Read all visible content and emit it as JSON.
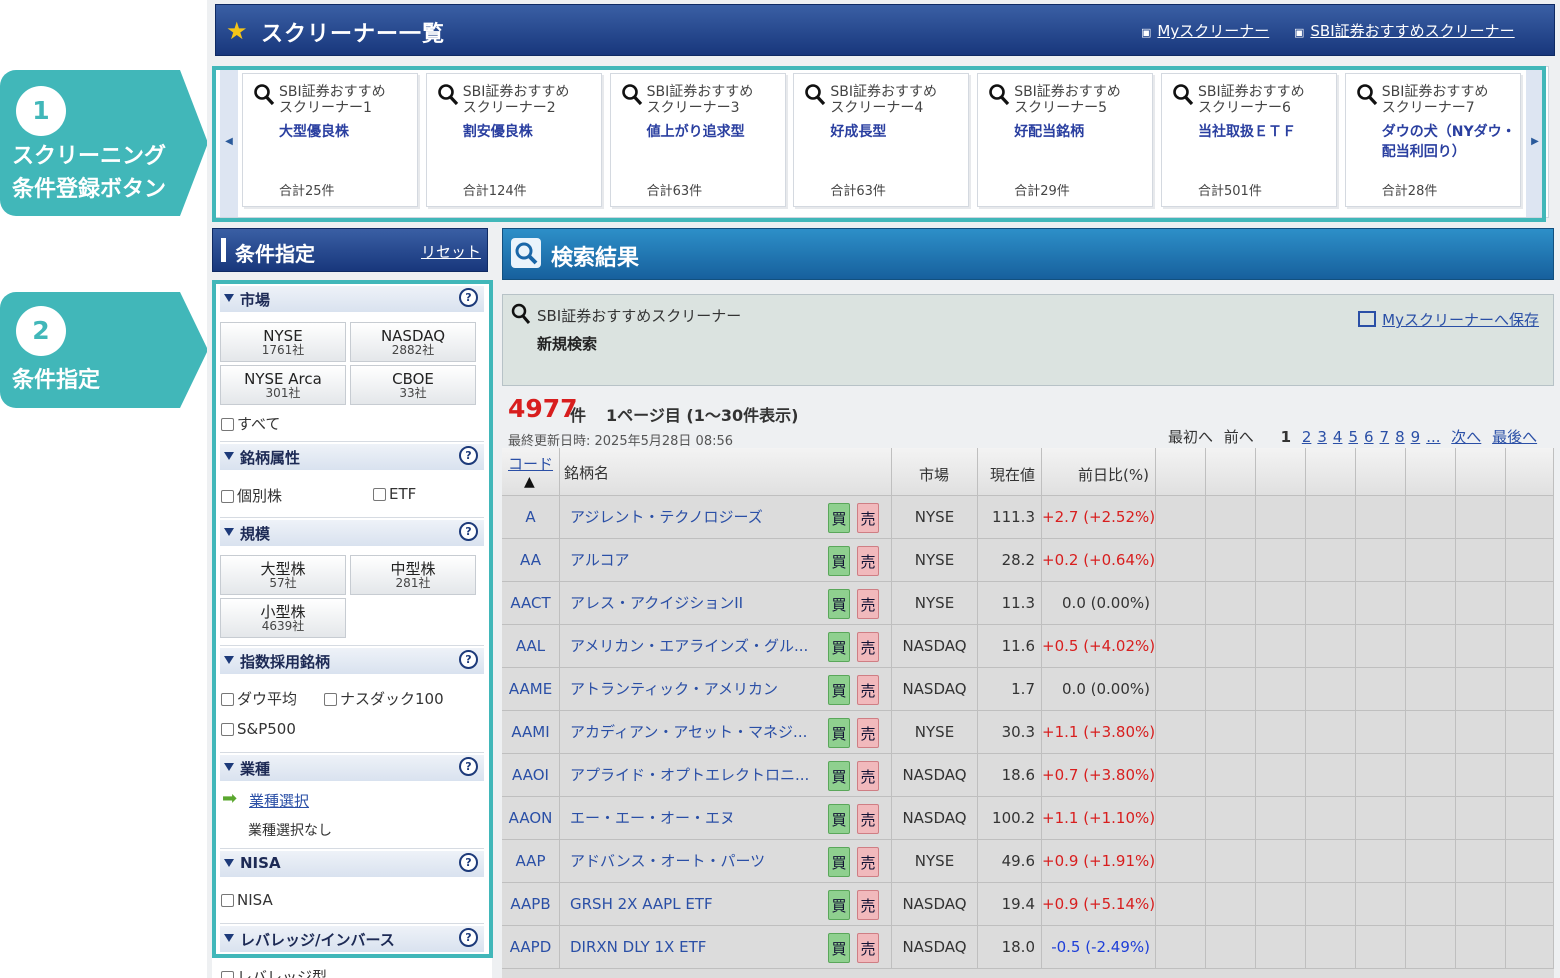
{
  "callouts": [
    {
      "num": "1",
      "lines": [
        "スクリーニング",
        "条件登録ボタン"
      ]
    },
    {
      "num": "2",
      "lines": [
        "条件指定"
      ]
    }
  ],
  "header": {
    "title": "スクリーナー一覧",
    "link1": "Myスクリーナー",
    "link2": "SBI証券おすすめスクリーナー"
  },
  "screeners": [
    {
      "sub1": "SBI証券おすすめ",
      "sub2": "スクリーナー1",
      "name": "大型優良株",
      "count": "合計25件"
    },
    {
      "sub1": "SBI証券おすすめ",
      "sub2": "スクリーナー2",
      "name": "割安優良株",
      "count": "合計124件"
    },
    {
      "sub1": "SBI証券おすすめ",
      "sub2": "スクリーナー3",
      "name": "値上がり追求型",
      "count": "合計63件"
    },
    {
      "sub1": "SBI証券おすすめ",
      "sub2": "スクリーナー4",
      "name": "好成長型",
      "count": "合計63件"
    },
    {
      "sub1": "SBI証券おすすめ",
      "sub2": "スクリーナー5",
      "name": "好配当銘柄",
      "count": "合計29件"
    },
    {
      "sub1": "SBI証券おすすめ",
      "sub2": "スクリーナー6",
      "name": "当社取扱ＥＴＦ",
      "count": "合計501件"
    },
    {
      "sub1": "SBI証券おすすめ",
      "sub2": "スクリーナー7",
      "name": "ダウの犬（NYダウ・配当利回り）",
      "count": "合計28件"
    }
  ],
  "sidebar": {
    "title": "条件指定",
    "reset": "リセット",
    "market": {
      "label": "市場",
      "buttons": [
        {
          "name": "NYSE",
          "count": "1761社"
        },
        {
          "name": "NASDAQ",
          "count": "2882社"
        },
        {
          "name": "NYSE Arca",
          "count": "301社"
        },
        {
          "name": "CBOE",
          "count": "33社"
        }
      ],
      "all": "すべて"
    },
    "attr": {
      "label": "銘柄属性",
      "opt1": "個別株",
      "opt2": "ETF"
    },
    "scale": {
      "label": "規模",
      "buttons": [
        {
          "name": "大型株",
          "count": "57社"
        },
        {
          "name": "中型株",
          "count": "281社"
        },
        {
          "name": "小型株",
          "count": "4639社"
        }
      ]
    },
    "index": {
      "label": "指数採用銘柄",
      "opt1": "ダウ平均",
      "opt2": "ナスダック100",
      "opt3": "S&P500"
    },
    "industry": {
      "label": "業種",
      "link": "業種選択",
      "none": "業種選択なし"
    },
    "nisa": {
      "label": "NISA",
      "opt1": "NISA"
    },
    "leverage": {
      "label": "レバレッジ/インバース",
      "opt1": "レバレッジ型"
    },
    "help": "?"
  },
  "results": {
    "title": "検索結果",
    "screener": "SBI証券おすすめスクリーナー",
    "search": "新規検索",
    "save": "Myスクリーナーへ保存",
    "count": "4977",
    "unit": "件",
    "page_info": "1ページ目 (1〜30件表示)",
    "updated": "最終更新日時:  2025年5月28日 08:56",
    "pager": {
      "first": "最初へ",
      "prev": "前へ",
      "current": "1",
      "pages": [
        "2",
        "3",
        "4",
        "5",
        "6",
        "7",
        "8",
        "9",
        "..."
      ],
      "next": "次へ",
      "last": "最後へ"
    },
    "columns": {
      "code": "コード",
      "sort": "▲",
      "name": "銘柄名",
      "market": "市場",
      "price": "現在値",
      "change": "前日比(%)"
    },
    "buy": "買",
    "sell": "売",
    "rows": [
      {
        "code": "A",
        "name": "アジレント・テクノロジーズ",
        "market": "NYSE",
        "price": "111.3",
        "change": "+2.7 (+2.52%)",
        "dir": "up"
      },
      {
        "code": "AA",
        "name": "アルコア",
        "market": "NYSE",
        "price": "28.2",
        "change": "+0.2 (+0.64%)",
        "dir": "up"
      },
      {
        "code": "AACT",
        "name": "アレス・アクイジションII",
        "market": "NYSE",
        "price": "11.3",
        "change": "0.0 (0.00%)",
        "dir": "flat"
      },
      {
        "code": "AAL",
        "name": "アメリカン・エアラインズ・グル...",
        "market": "NASDAQ",
        "price": "11.6",
        "change": "+0.5 (+4.02%)",
        "dir": "up"
      },
      {
        "code": "AAME",
        "name": "アトランティック・アメリカン",
        "market": "NASDAQ",
        "price": "1.7",
        "change": "0.0 (0.00%)",
        "dir": "flat"
      },
      {
        "code": "AAMI",
        "name": "アカディアン・アセット・マネジ...",
        "market": "NYSE",
        "price": "30.3",
        "change": "+1.1 (+3.80%)",
        "dir": "up"
      },
      {
        "code": "AAOI",
        "name": "アプライド・オプトエレクトロニ...",
        "market": "NASDAQ",
        "price": "18.6",
        "change": "+0.7 (+3.80%)",
        "dir": "up"
      },
      {
        "code": "AAON",
        "name": "エー・エー・オー・エヌ",
        "market": "NASDAQ",
        "price": "100.2",
        "change": "+1.1 (+1.10%)",
        "dir": "up"
      },
      {
        "code": "AAP",
        "name": "アドバンス・オート・パーツ",
        "market": "NYSE",
        "price": "49.6",
        "change": "+0.9 (+1.91%)",
        "dir": "up"
      },
      {
        "code": "AAPB",
        "name": "GRSH 2X AAPL ETF",
        "market": "NASDAQ",
        "price": "19.4",
        "change": "+0.9 (+5.14%)",
        "dir": "up"
      },
      {
        "code": "AAPD",
        "name": "DIRXN DLY 1X ETF",
        "market": "NASDAQ",
        "price": "18.0",
        "change": "-0.5 (-2.49%)",
        "dir": "down"
      }
    ]
  },
  "colors": {
    "teal": "#41b7b9",
    "navy": "#18377c",
    "up": "#d81e1e",
    "down": "#1e3fd8"
  }
}
